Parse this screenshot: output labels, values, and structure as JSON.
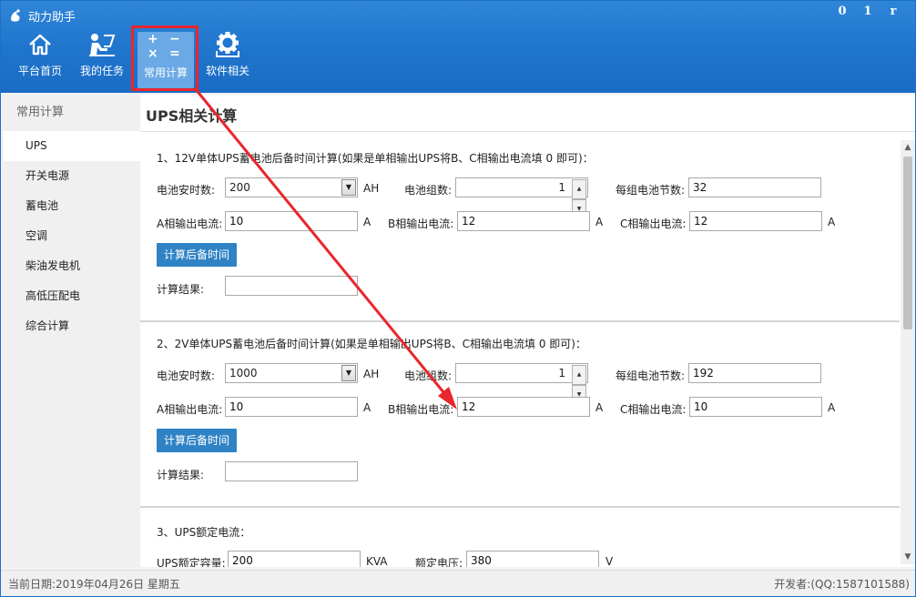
{
  "app": {
    "title": "动力助手",
    "window_controls": [
      "0",
      "1",
      "r"
    ]
  },
  "toolbar": {
    "items": [
      {
        "label": "平台首页",
        "icon": "home-icon"
      },
      {
        "label": "我的任务",
        "icon": "task-icon"
      },
      {
        "label": "常用计算",
        "icon": "calculator-icon",
        "active": true
      },
      {
        "label": "软件相关",
        "icon": "gear-icon"
      }
    ],
    "calc_symbols": [
      "+",
      "−",
      "×",
      "="
    ]
  },
  "sidebar": {
    "header": "常用计算",
    "items": [
      {
        "label": "UPS",
        "active": true
      },
      {
        "label": "开关电源"
      },
      {
        "label": "蓄电池"
      },
      {
        "label": "空调"
      },
      {
        "label": "柴油发电机"
      },
      {
        "label": "高低压配电"
      },
      {
        "label": "综合计算"
      }
    ]
  },
  "main": {
    "title": "UPS相关计算",
    "sections": [
      {
        "title": "1、12V单体UPS蓄电池后备时间计算(如果是单相输出UPS将B、C相输出电流填 0 即可)：",
        "capacity_label": "电池安时数:",
        "capacity_value": "200",
        "capacity_unit": "AH",
        "groups_label": "电池组数:",
        "groups_value": "1",
        "cells_label": "每组电池节数:",
        "cells_value": "32",
        "a_label": "A相输出电流:",
        "a_value": "10",
        "a_unit": "A",
        "b_label": "B相输出电流:",
        "b_value": "12",
        "b_unit": "A",
        "c_label": "C相输出电流:",
        "c_value": "12",
        "c_unit": "A",
        "button": "计算后备时间",
        "result_label": "计算结果:",
        "result_value": ""
      },
      {
        "title": "2、2V单体UPS蓄电池后备时间计算(如果是单相输出UPS将B、C相输出电流填 0 即可)：",
        "capacity_label": "电池安时数:",
        "capacity_value": "1000",
        "capacity_unit": "AH",
        "groups_label": "电池组数:",
        "groups_value": "1",
        "cells_label": "每组电池节数:",
        "cells_value": "192",
        "a_label": "A相输出电流:",
        "a_value": "10",
        "a_unit": "A",
        "b_label": "B相输出电流:",
        "b_value": "12",
        "b_unit": "A",
        "c_label": "C相输出电流:",
        "c_value": "10",
        "c_unit": "A",
        "button": "计算后备时间",
        "result_label": "计算结果:",
        "result_value": ""
      },
      {
        "title": "3、UPS额定电流：",
        "capacity_label": "UPS额定容量:",
        "capacity_value": "200",
        "capacity_unit": "KVA",
        "voltage_label": "额定电压:",
        "voltage_value": "380",
        "voltage_unit": "V"
      }
    ]
  },
  "status": {
    "date": "当前日期:2019年04月26日 星期五",
    "developer": "开发者:(QQ:1587101588)"
  },
  "colors": {
    "header": "#1f74cc",
    "button": "#2f83c5",
    "highlight": "#e8262c"
  }
}
